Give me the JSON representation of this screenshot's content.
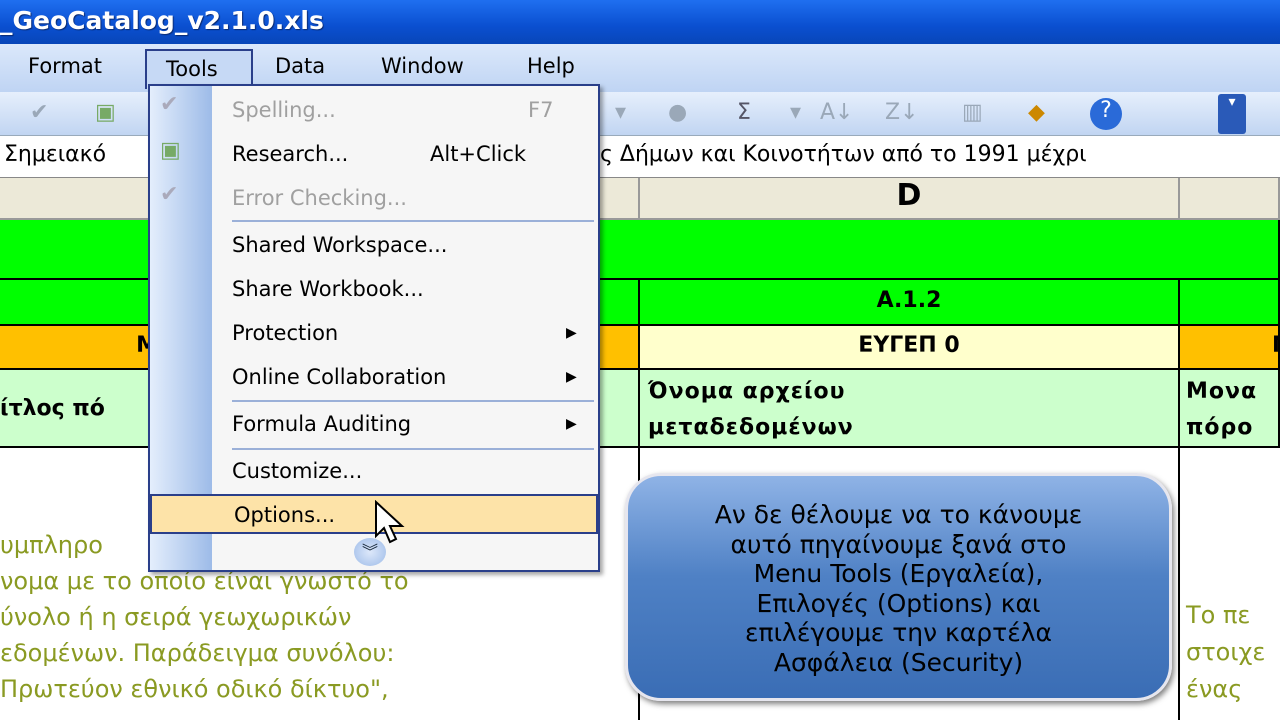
{
  "window": {
    "title": "_GeoCatalog_v2.1.0.xls"
  },
  "menubar": {
    "items": [
      "Format",
      "Tools",
      "Data",
      "Window",
      "Help"
    ],
    "active": "Tools"
  },
  "formula_bar": {
    "text_left": "Σημειακό",
    "text_right": "ς Δήμων και Κοινοτήτων από το 1991 μέχρι"
  },
  "sheet": {
    "column_header": "D",
    "row_a12": "A.1.2",
    "row_code": {
      "left": "Μ",
      "middle": "ΕΥΓΕΠ 0",
      "right": "Μ"
    },
    "row_title": {
      "left": "ίτλος πό",
      "middle_line1": "Όνομα αρχείου",
      "middle_line2": "μεταδεδομένων",
      "right_line1": "Μονα",
      "right_line2": "πόρο"
    },
    "left_text": [
      "υμπληρο",
      "νομα με το οποίο είναι γνωστό το",
      "ύνολο ή η σειρά  γεωχωρικών",
      "εδομένων. Παράδειγμα συνόλου:",
      "Πρωτεύον εθνικό οδικό δίκτυο\","
    ],
    "right_text": [
      "Το πε",
      "στοιχε",
      "ένας"
    ],
    "colors": {
      "green": "#00ff00",
      "orange": "#ffc000",
      "light_yellow": "#ffffcc",
      "light_green": "#ccffcc",
      "text_olive": "#8a9a22"
    }
  },
  "tools_menu": {
    "items": [
      {
        "label": "Spelling...",
        "shortcut": "F7",
        "enabled": false,
        "icon": "spelling-icon"
      },
      {
        "label": "Research...",
        "shortcut": "Alt+Click",
        "enabled": true,
        "icon": "research-icon"
      },
      {
        "label": "Error Checking...",
        "enabled": false,
        "icon": "error-checking-icon"
      },
      {
        "label": "Shared Workspace...",
        "enabled": true
      },
      {
        "label": "Share Workbook...",
        "enabled": true
      },
      {
        "label": "Protection",
        "submenu": true
      },
      {
        "label": "Online Collaboration",
        "submenu": true
      },
      {
        "label": "Formula Auditing",
        "submenu": true
      },
      {
        "label": "Customize...",
        "enabled": true
      },
      {
        "label": "Options...",
        "enabled": true,
        "highlighted": true
      }
    ],
    "expand_icon": "double-chevron-down-icon"
  },
  "callout": {
    "lines": [
      "Αν δε θέλουμε να το κάνουμε",
      "αυτό πηγαίνουμε ξανά στο",
      "Menu Tools (Εργαλεία),",
      "Επιλογές (Options) και",
      "επιλέγουμε την καρτέλα",
      "Ασφάλεια (Security)"
    ]
  }
}
